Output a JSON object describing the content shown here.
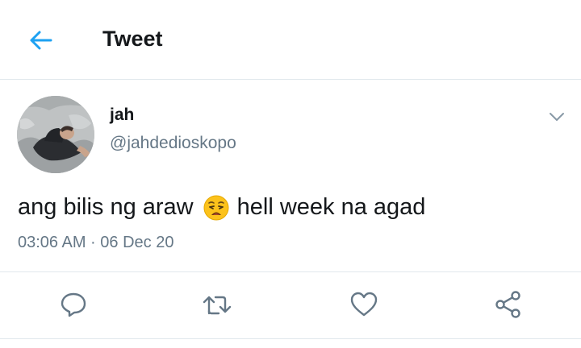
{
  "header": {
    "back_icon": "arrow-left-icon",
    "title": "Tweet"
  },
  "tweet": {
    "author": {
      "display_name": "jah",
      "handle": "@jahdedioskopo"
    },
    "text_before_emoji": "ang bilis ng araw",
    "emoji": "weary-face-emoji",
    "text_after_emoji": "hell week na agad",
    "timestamp": "03:06 AM · 06 Dec 20"
  },
  "actions": [
    {
      "icon": "reply-icon"
    },
    {
      "icon": "retweet-icon"
    },
    {
      "icon": "like-icon"
    },
    {
      "icon": "share-icon"
    }
  ],
  "colors": {
    "accent": "#1da1f2",
    "text_primary": "#14171a",
    "text_secondary": "#657786",
    "divider": "#e1e8ed",
    "icon": "#657786"
  }
}
